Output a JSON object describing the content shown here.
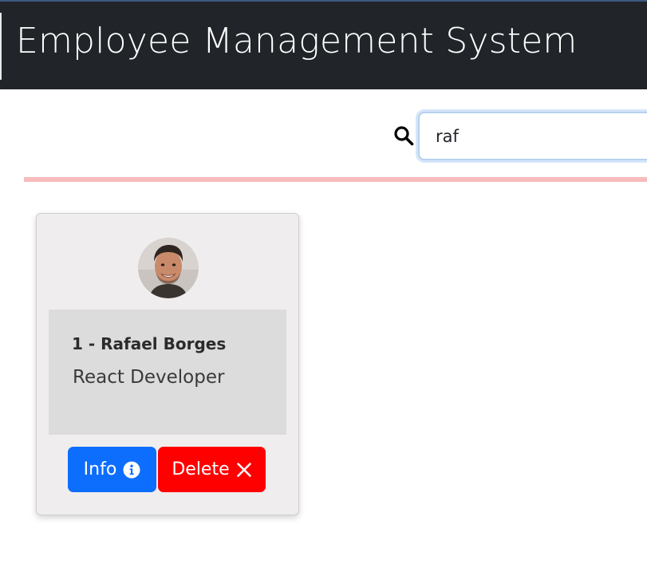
{
  "header": {
    "title": "Employee Management System"
  },
  "search": {
    "value": "raf",
    "icon": "search-icon"
  },
  "colors": {
    "header_bg": "#212529",
    "divider": "#f8bcbc",
    "card_bg": "#f0edee",
    "card_body_bg": "#dcdcdc",
    "info_button": "#0d6efd",
    "delete_button": "#ff0000"
  },
  "employees": [
    {
      "name": "1 - Rafael Borges",
      "role": "React Developer",
      "avatar_icon": "avatar",
      "info_label": "Info",
      "info_icon": "info-circle-icon",
      "delete_label": "Delete",
      "delete_icon": "close-icon"
    }
  ]
}
